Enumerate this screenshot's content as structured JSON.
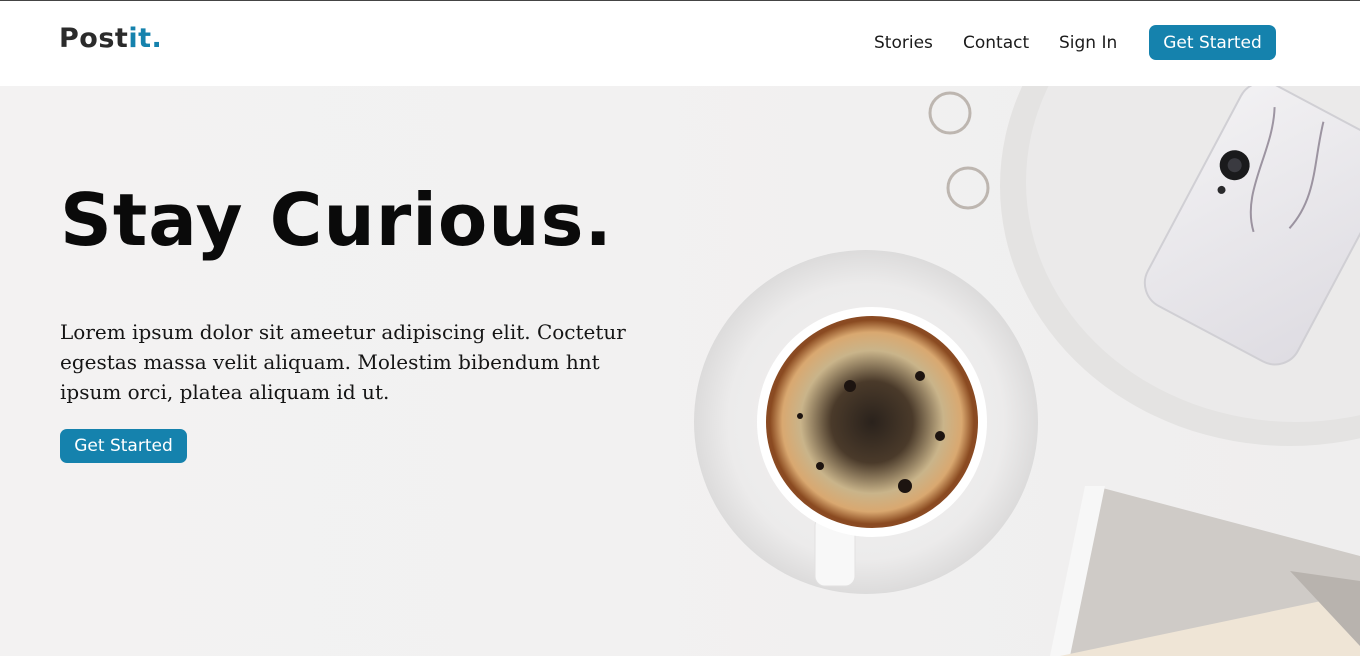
{
  "nav": {
    "logo_main": "Post",
    "logo_accent": "it.",
    "links": [
      "Stories",
      "Contact",
      "Sign In"
    ],
    "cta_label": "Get Started"
  },
  "hero": {
    "title": "Stay Curious.",
    "description": "Lorem ipsum dolor sit ameetur adipiscing elit. Coctetur egestas massa velit aliquam. Molestim bibendum hnt ipsum orci, platea aliquam id ut.",
    "cta_label": "Get Started",
    "image": "coffee-cup-desk-flatlay"
  },
  "colors": {
    "accent": "#1582ad",
    "text": "#0a0a0a",
    "background": "#f1f0f0"
  }
}
